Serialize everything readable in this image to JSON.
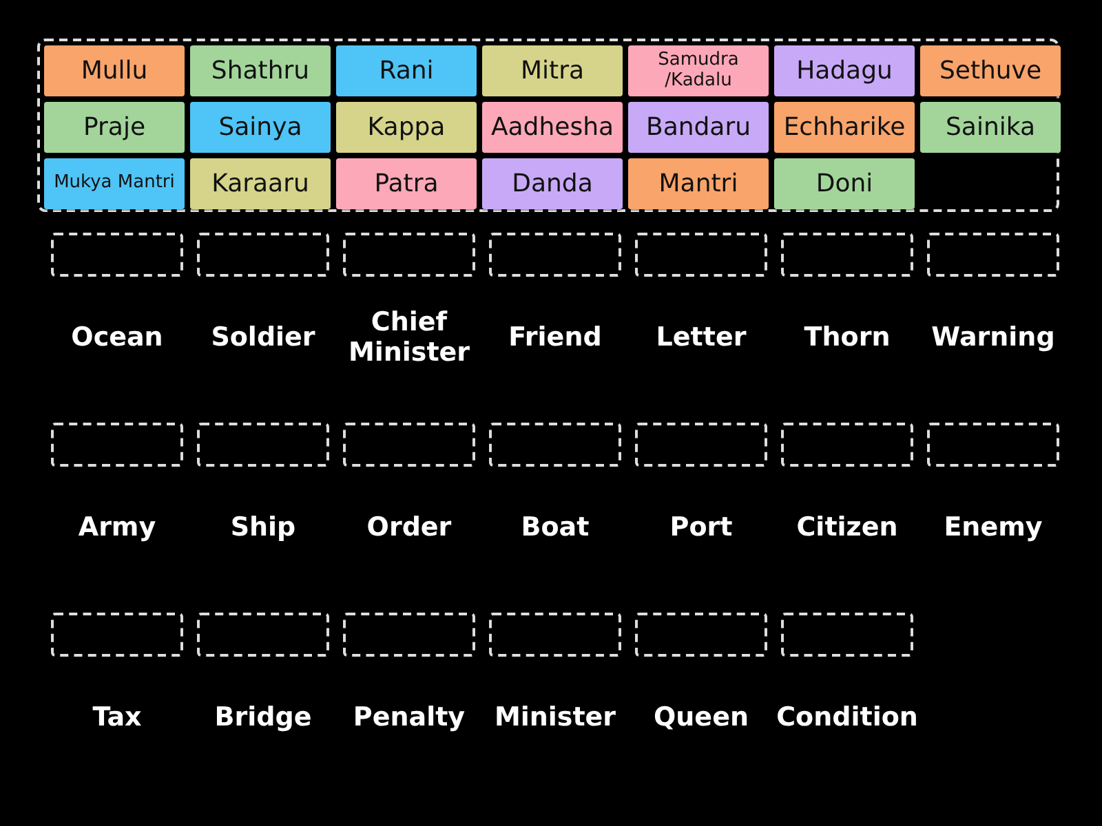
{
  "tiles": [
    {
      "text": "Mullu",
      "color": "#f9a46b",
      "kind": "word"
    },
    {
      "text": "Shathru",
      "color": "#a3d59b",
      "kind": "word"
    },
    {
      "text": "Rani",
      "color": "#4fc4f7",
      "kind": "word"
    },
    {
      "text": "Mitra",
      "color": "#d5d48a",
      "kind": "word"
    },
    {
      "text": "Samudra /Kadalu",
      "color": "#fda8b8",
      "kind": "compact"
    },
    {
      "text": "Hadagu",
      "color": "#c8a9f7",
      "kind": "word"
    },
    {
      "text": "Sethuve",
      "color": "#f9a46b",
      "kind": "word"
    },
    {
      "text": "Praje",
      "color": "#a3d59b",
      "kind": "word"
    },
    {
      "text": "Sainya",
      "color": "#4fc4f7",
      "kind": "word"
    },
    {
      "text": "Kappa",
      "color": "#d5d48a",
      "kind": "word"
    },
    {
      "text": "Aadhesha",
      "color": "#fda8b8",
      "kind": "word"
    },
    {
      "text": "Bandaru",
      "color": "#c8a9f7",
      "kind": "word"
    },
    {
      "text": "Echharike",
      "color": "#f9a46b",
      "kind": "word"
    },
    {
      "text": "Sainika",
      "color": "#a3d59b",
      "kind": "word"
    },
    {
      "text": "Mukya Mantri",
      "color": "#4fc4f7",
      "kind": "compact"
    },
    {
      "text": "Karaaru",
      "color": "#d5d48a",
      "kind": "word"
    },
    {
      "text": "Patra",
      "color": "#fda8b8",
      "kind": "word"
    },
    {
      "text": "Danda",
      "color": "#c8a9f7",
      "kind": "word"
    },
    {
      "text": "Mantri",
      "color": "#f9a46b",
      "kind": "word"
    },
    {
      "text": "Doni",
      "color": "#a3d59b",
      "kind": "word"
    }
  ],
  "targets": [
    {
      "label": "Ocean"
    },
    {
      "label": "Soldier"
    },
    {
      "label": "Chief Minister"
    },
    {
      "label": "Friend"
    },
    {
      "label": "Letter"
    },
    {
      "label": "Thorn"
    },
    {
      "label": "Warning"
    },
    {
      "label": "Army"
    },
    {
      "label": "Ship"
    },
    {
      "label": "Order"
    },
    {
      "label": "Boat"
    },
    {
      "label": "Port"
    },
    {
      "label": "Citizen"
    },
    {
      "label": "Enemy"
    },
    {
      "label": "Tax"
    },
    {
      "label": "Bridge"
    },
    {
      "label": "Penalty"
    },
    {
      "label": "Minister"
    },
    {
      "label": "Queen"
    },
    {
      "label": "Condition"
    }
  ]
}
